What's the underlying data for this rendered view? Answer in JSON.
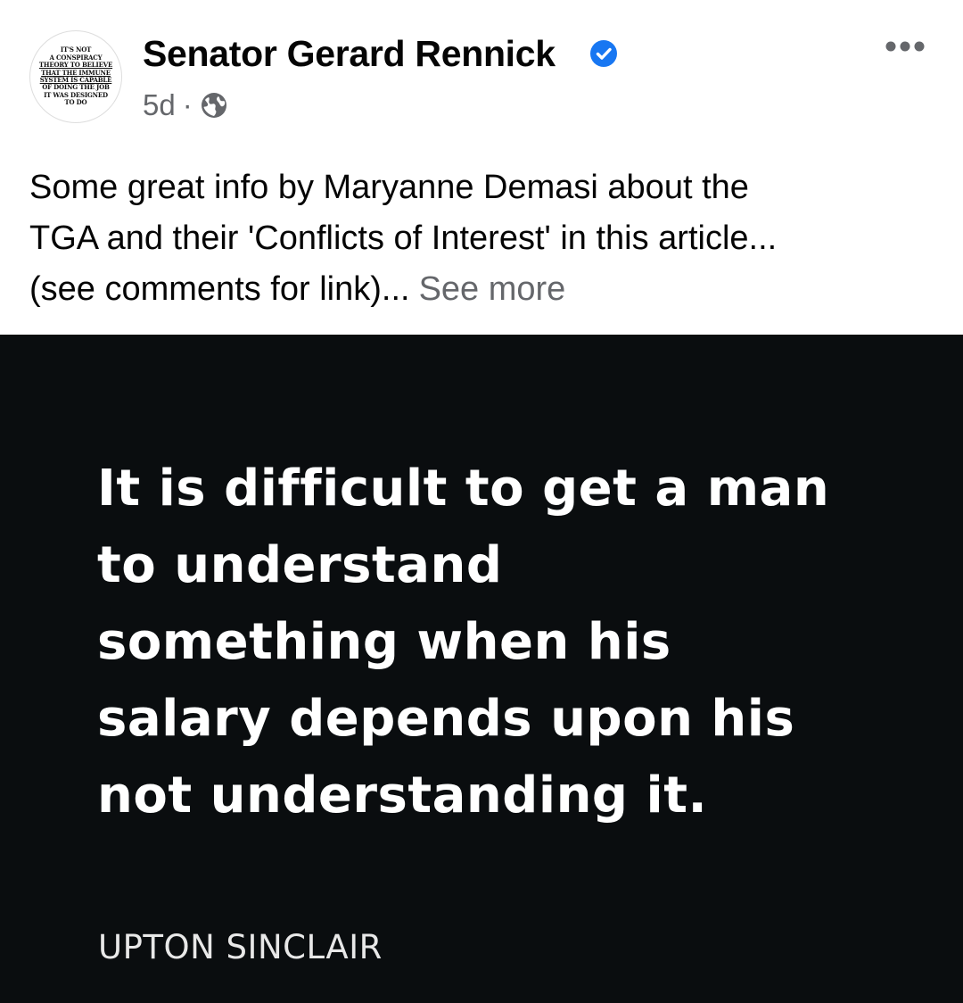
{
  "post": {
    "author": {
      "name": "Senator Gerard Rennick",
      "verified_icon": "verified-badge-icon",
      "avatar_text": [
        "IT'S NOT",
        "A CONSPIRACY",
        "THEORY TO BELIEVE",
        "THAT THE IMMUNE",
        "SYSTEM IS CAPABLE",
        "OF DOING THE JOB",
        "IT WAS DESIGNED",
        "TO DO"
      ]
    },
    "meta": {
      "time": "5d",
      "separator": "·",
      "audience_icon": "globe-icon"
    },
    "more_icon": "more-options-icon",
    "caption": {
      "lines": [
        "Some great info by Maryanne Demasi about the",
        "TGA and their 'Conflicts of Interest' in this article...",
        "(see comments for link)..."
      ],
      "see_more": "See more"
    },
    "image": {
      "quote_lines": [
        "It is difficult to get a man",
        "to understand",
        "something when his",
        "salary depends upon his",
        "not understanding it."
      ],
      "attribution": "UPTON SINCLAIR"
    }
  },
  "colors": {
    "text_primary": "#050505",
    "text_secondary": "#65676b",
    "verified_blue": "#1877f2",
    "image_background": "#0a0d0f"
  }
}
